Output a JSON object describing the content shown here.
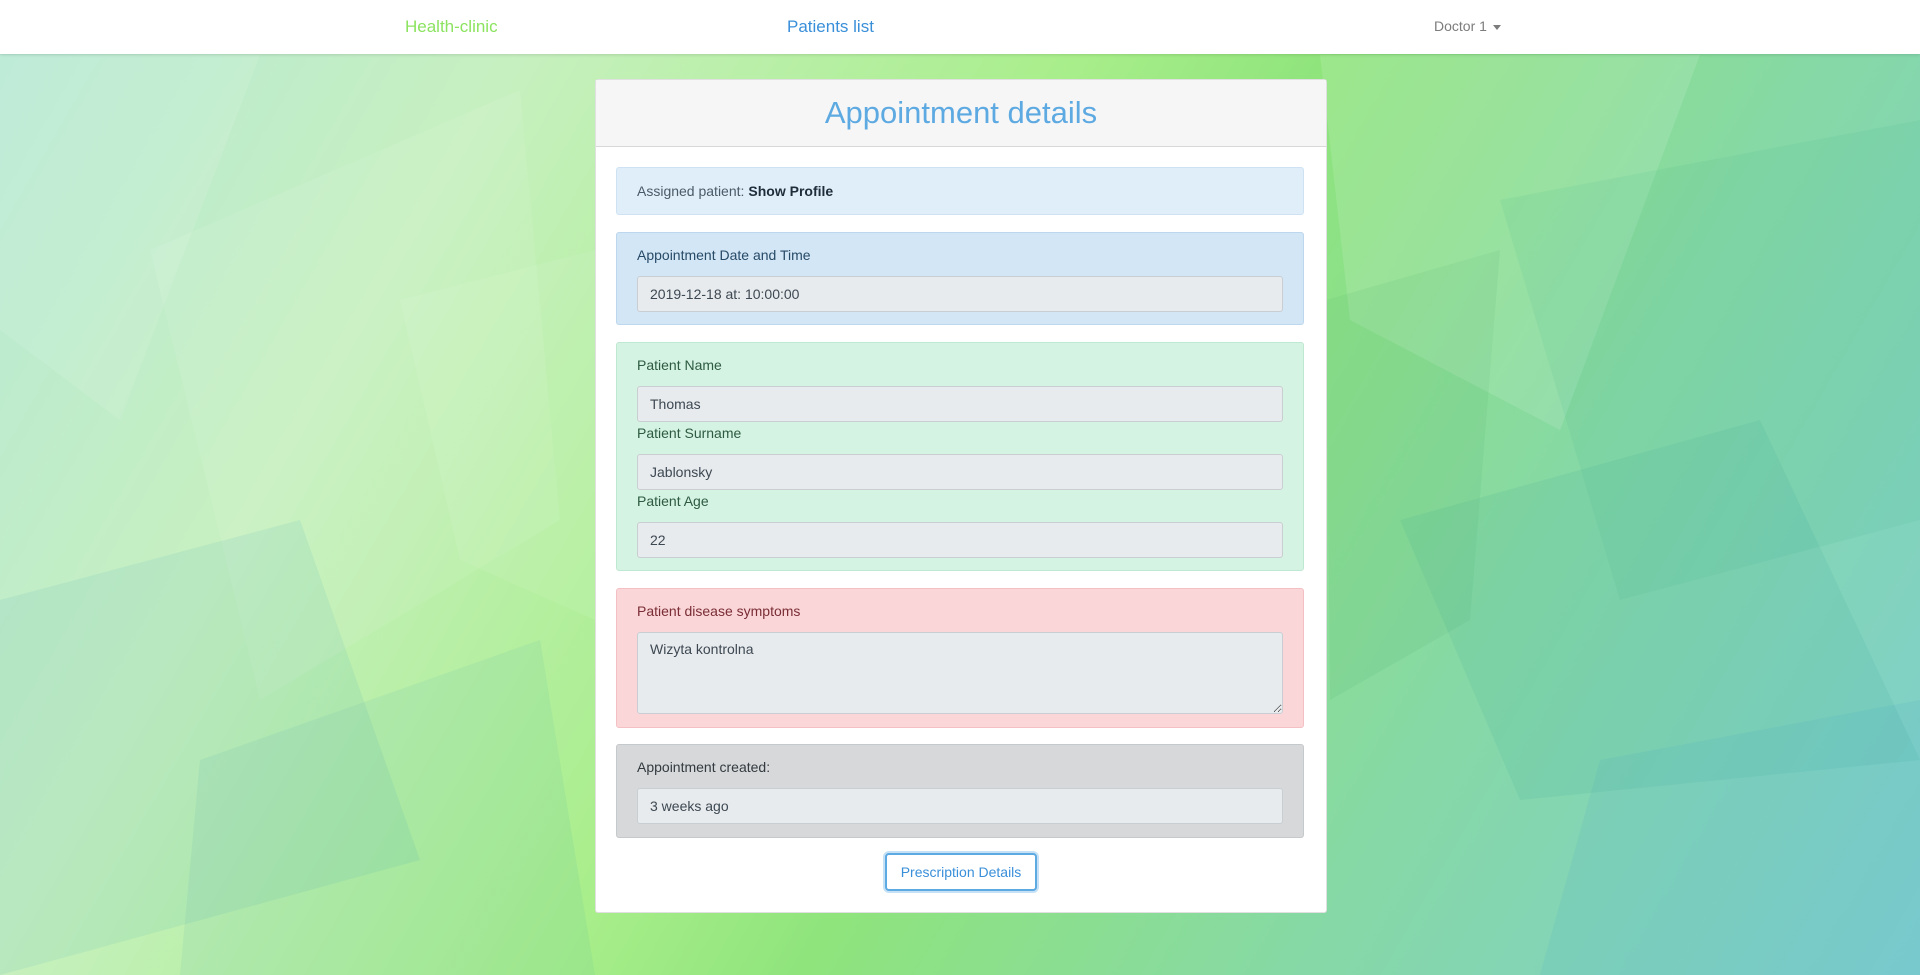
{
  "navbar": {
    "brand": "Health-clinic",
    "patients_link": "Patients list",
    "user_menu": "Doctor 1"
  },
  "card": {
    "title": "Appointment details"
  },
  "assigned_patient": {
    "label": "Assigned patient:",
    "link": "Show Profile"
  },
  "appointment": {
    "label": "Appointment Date and Time",
    "value": "2019-12-18 at: 10:00:00"
  },
  "patient": {
    "name_label": "Patient Name",
    "name_value": "Thomas",
    "surname_label": "Patient Surname",
    "surname_value": "Jablonsky",
    "age_label": "Patient Age",
    "age_value": "22"
  },
  "symptoms": {
    "label": "Patient disease symptoms",
    "value": "Wizyta kontrolna"
  },
  "created": {
    "label": "Appointment created:",
    "value": "3 weeks ago"
  },
  "actions": {
    "prescription_button": "Prescription Details"
  },
  "colors": {
    "brand": "#8be35f",
    "link": "#3a8fd9",
    "title": "#5da9e2",
    "info_panel": "#e0eefa",
    "blue_panel": "#d3e6f6",
    "green_panel": "#d5f3e3",
    "red_panel": "#fad6d8",
    "gray_panel": "#d6d8d9"
  },
  "icons": {
    "user_menu": "caret-down-icon"
  }
}
